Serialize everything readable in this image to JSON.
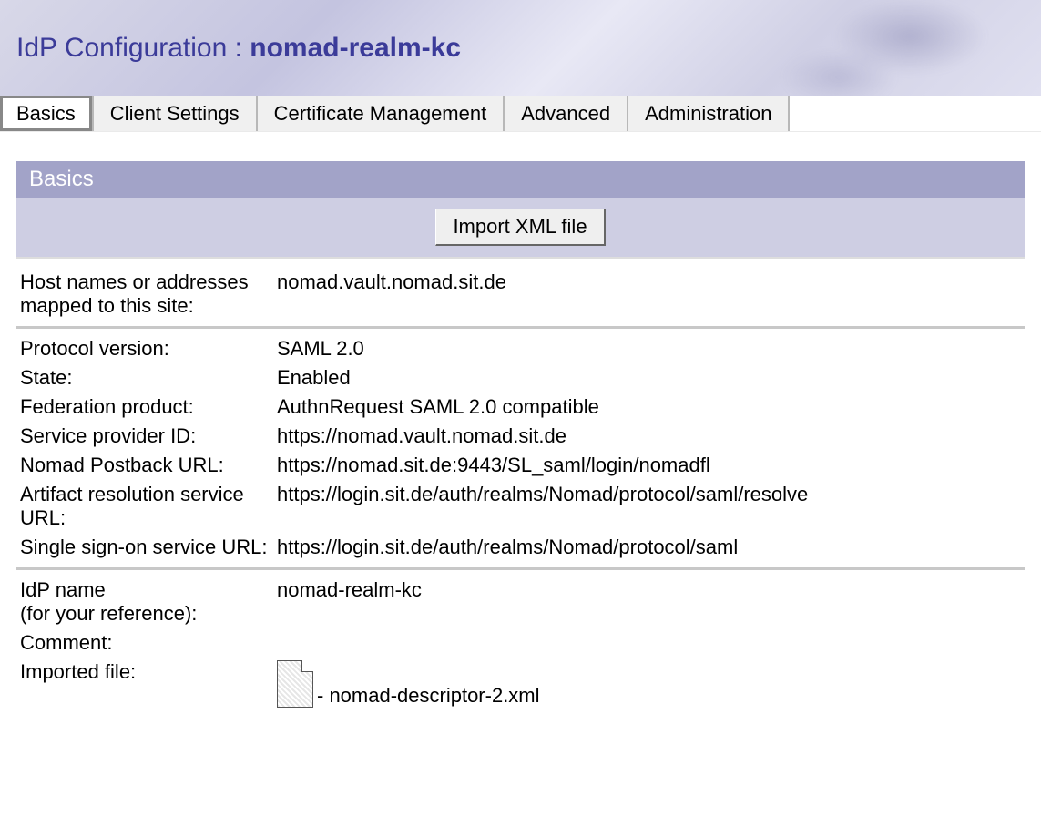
{
  "header": {
    "title_prefix": "IdP Configuration : ",
    "title_name": "nomad-realm-kc"
  },
  "tabs": [
    {
      "label": "Basics",
      "active": true
    },
    {
      "label": "Client Settings",
      "active": false
    },
    {
      "label": "Certificate Management",
      "active": false
    },
    {
      "label": "Advanced",
      "active": false
    },
    {
      "label": "Administration",
      "active": false
    }
  ],
  "section": {
    "title": "Basics",
    "import_button": "Import XML file"
  },
  "rows_group1": [
    {
      "k": "Host names or addresses mapped to this site:",
      "v": "nomad.vault.nomad.sit.de"
    }
  ],
  "rows_group2": [
    {
      "k": "Protocol version:",
      "v": "SAML 2.0"
    },
    {
      "k": "State:",
      "v": "Enabled"
    },
    {
      "k": "Federation product:",
      "v": "AuthnRequest SAML 2.0 compatible"
    },
    {
      "k": "Service provider ID:",
      "v": "https://nomad.vault.nomad.sit.de"
    },
    {
      "k": "Nomad Postback URL:",
      "v": "https://nomad.sit.de:9443/SL_saml/login/nomadfl"
    },
    {
      "k": "Artifact resolution service URL:",
      "v": "https://login.sit.de/auth/realms/Nomad/protocol/saml/resolve"
    },
    {
      "k": "Single sign-on service URL:",
      "v": "https://login.sit.de/auth/realms/Nomad/protocol/saml"
    }
  ],
  "rows_group3": {
    "idp_name_label": "IdP name",
    "idp_name_sub": "(for your reference):",
    "idp_name_value": "nomad-realm-kc",
    "comment_label": "Comment:",
    "comment_value": "",
    "imported_label": "Imported file:",
    "imported_value": " - nomad-descriptor-2.xml"
  }
}
